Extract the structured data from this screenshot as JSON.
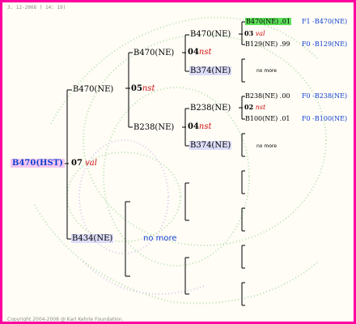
{
  "header": {
    "date": "3. 12-2008 ( 14: 19)"
  },
  "footer": {
    "copyright": "Copyright 2004-2008 @ Karl Kehrle Foundation."
  },
  "root": {
    "name": "B470(HST)",
    "num": "07",
    "tag": "val"
  },
  "gen1": [
    {
      "name": "B470(NE)",
      "num": "05",
      "tag": "nst"
    },
    {
      "name": "B434(NE)",
      "nomore": "no more"
    }
  ],
  "gen2": [
    {
      "name": "B470(NE)",
      "num": "04",
      "tag": "nst"
    },
    {
      "name": "B238(NE)",
      "num": "04",
      "tag": "nst"
    }
  ],
  "gen3": [
    {
      "name": "B470(NE)",
      "num": "03",
      "tag": "val"
    },
    {
      "name": "B374(NE)",
      "nomore": "no more"
    },
    {
      "name": "B238(NE)",
      "num": "02",
      "tag": "nst"
    },
    {
      "name": "B374(NE)",
      "nomore": "no more"
    }
  ],
  "gen4": [
    {
      "name": "B470(NE)",
      "value": ".01",
      "ref": "F1 -B470(NE)"
    },
    {
      "name": "B129(NE)",
      "value": ".99",
      "ref": "F0 -B129(NE)"
    },
    {
      "name": "B238(NE)",
      "value": ".00",
      "ref": "F0 -B238(NE)"
    },
    {
      "name": "B100(NE)",
      "value": ".01",
      "ref": "F0 -B100(NE)"
    }
  ],
  "colors": {
    "frame": "#ff00a0",
    "highlight": "#5de05a",
    "boxed": "#dcdcf8",
    "root_bg": "#f5c8f0",
    "link": "#1040d0",
    "tag": "#d01010"
  }
}
